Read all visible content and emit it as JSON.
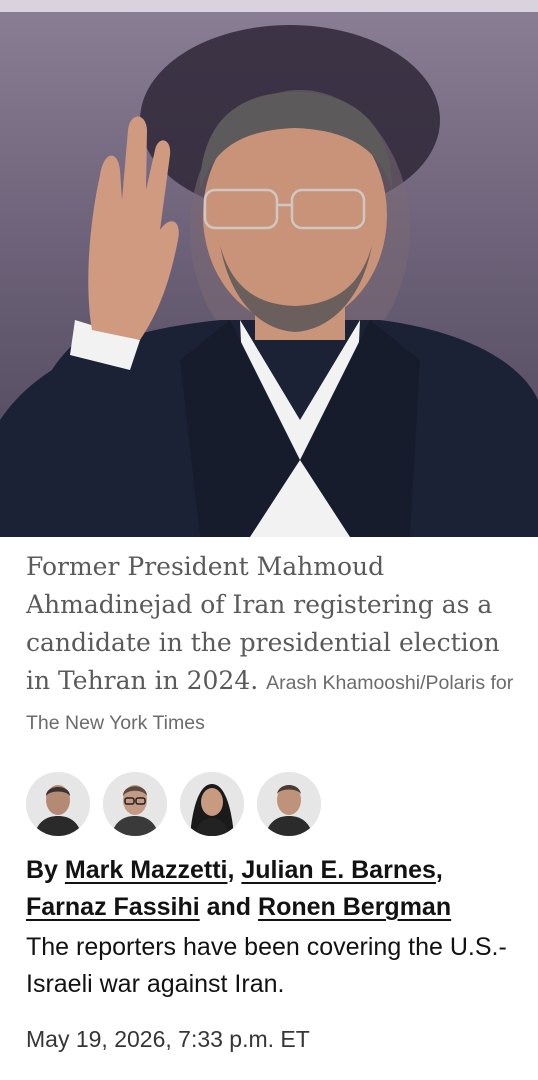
{
  "photo": {
    "alt_subject": "photo"
  },
  "caption": {
    "text": "Former President Mahmoud Ahmadinejad of Iran registering as a candidate in the presidential election in Tehran in 2024.",
    "credit": "Arash Khamooshi/Polaris for The New York Times"
  },
  "authors": {
    "prefix": "By",
    "names": [
      "Mark Mazzetti",
      "Julian E. Barnes",
      "Farnaz Fassihi",
      "Ronen Bergman"
    ],
    "sep1": ",",
    "sep2": ",",
    "conj": "and"
  },
  "description": "The reporters have been covering the U.S.-Israeli war against Iran.",
  "timestamp": "May 19, 2026, 7:33 p.m. ET",
  "colors": {
    "caption_text": "#5a5a5a",
    "body_text": "#121212",
    "meta_text": "#363636"
  }
}
